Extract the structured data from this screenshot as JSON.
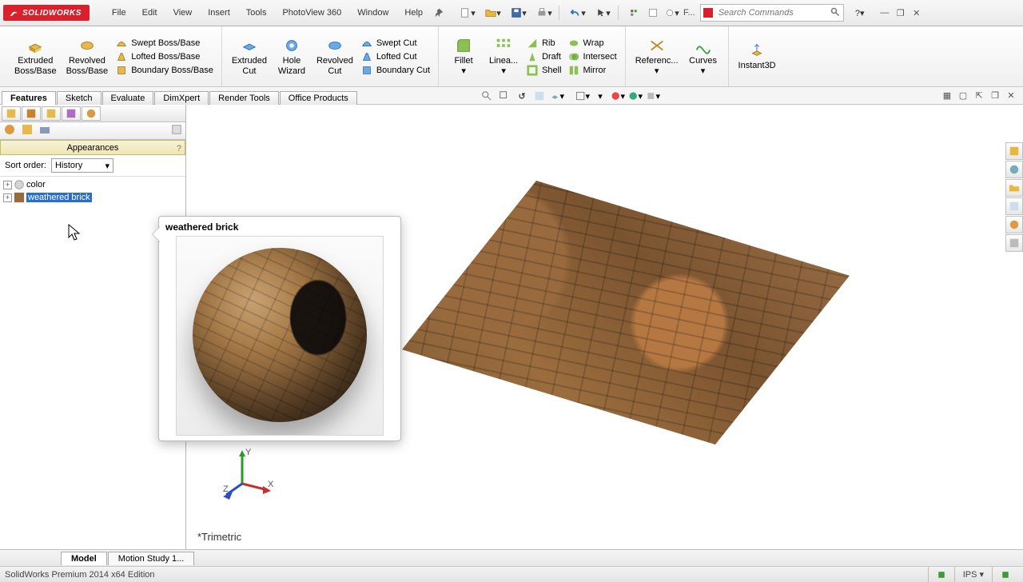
{
  "app": {
    "name": "SOLIDWORKS"
  },
  "menus": [
    "File",
    "Edit",
    "View",
    "Insert",
    "Tools",
    "PhotoView 360",
    "Window",
    "Help"
  ],
  "search": {
    "placeholder": "Search Commands"
  },
  "qat": {
    "file_hint": "F..."
  },
  "ribbon": {
    "big": [
      {
        "line1": "Extruded",
        "line2": "Boss/Base"
      },
      {
        "line1": "Revolved",
        "line2": "Boss/Base"
      }
    ],
    "boss_small": [
      "Swept Boss/Base",
      "Lofted Boss/Base",
      "Boundary Boss/Base"
    ],
    "cut_big": [
      {
        "line1": "Extruded",
        "line2": "Cut"
      },
      {
        "line1": "Hole",
        "line2": "Wizard"
      },
      {
        "line1": "Revolved",
        "line2": "Cut"
      }
    ],
    "cut_small": [
      "Swept Cut",
      "Lofted Cut",
      "Boundary Cut"
    ],
    "feat_big": [
      "Fillet",
      "Linea..."
    ],
    "feat_small1": [
      "Rib",
      "Draft",
      "Shell"
    ],
    "feat_small2": [
      "Wrap",
      "Intersect",
      "Mirror"
    ],
    "ref": [
      "Referenc...",
      "Curves",
      "Instant3D"
    ]
  },
  "doc_tabs": [
    "Features",
    "Sketch",
    "Evaluate",
    "DimXpert",
    "Render Tools",
    "Office Products"
  ],
  "panel": {
    "title": "Appearances",
    "sort_label": "Sort order:",
    "sort_value": "History",
    "tree": [
      {
        "label": "color",
        "selected": false
      },
      {
        "label": "weathered brick",
        "selected": true
      }
    ]
  },
  "preview": {
    "title": "weathered brick"
  },
  "viewport": {
    "orientation": "*Trimetric"
  },
  "bottom_tabs": [
    "Model",
    "Motion Study 1..."
  ],
  "status": {
    "edition": "SolidWorks Premium 2014 x64 Edition",
    "units": "IPS"
  },
  "colors": {
    "accent": "#d9202d",
    "sel": "#2a6fcd"
  }
}
